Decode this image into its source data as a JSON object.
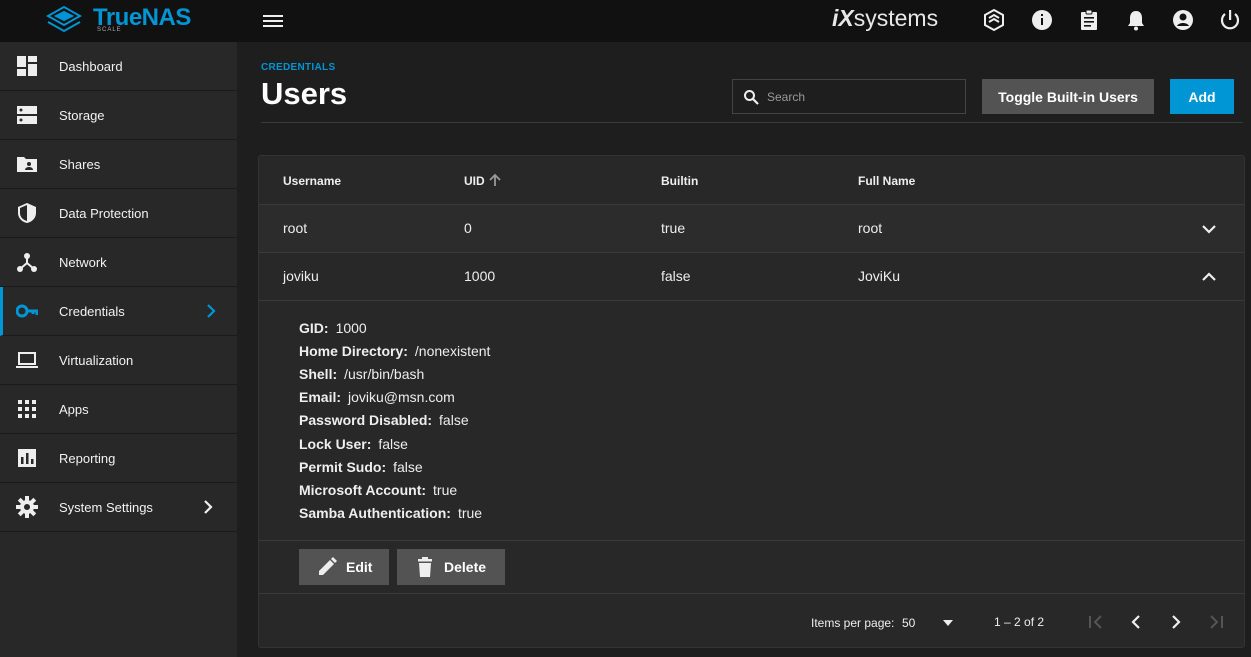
{
  "app": {
    "logo_text": "TrueNAS",
    "logo_edition": "SCALE",
    "vendor_logo_ix": "iX",
    "vendor_logo_text": "systems"
  },
  "colors": {
    "accent": "#0095d5",
    "topbar": "#111111",
    "sidebar": "#282828",
    "background": "#1e1e1e",
    "button_gray": "#535353"
  },
  "topbar": {
    "icons": [
      "hamburger-menu-icon",
      "truecommand-icon",
      "info-icon",
      "clipboard-icon",
      "bell-icon",
      "account-icon",
      "power-icon"
    ]
  },
  "sidebar": {
    "items": [
      {
        "label": "Dashboard",
        "icon": "dashboard-icon"
      },
      {
        "label": "Storage",
        "icon": "storage-icon"
      },
      {
        "label": "Shares",
        "icon": "shares-icon"
      },
      {
        "label": "Data Protection",
        "icon": "shield-icon"
      },
      {
        "label": "Network",
        "icon": "network-icon"
      },
      {
        "label": "Credentials",
        "icon": "key-icon",
        "active": true,
        "has_submenu": true
      },
      {
        "label": "Virtualization",
        "icon": "laptop-icon"
      },
      {
        "label": "Apps",
        "icon": "apps-grid-icon"
      },
      {
        "label": "Reporting",
        "icon": "chart-icon"
      },
      {
        "label": "System Settings",
        "icon": "gear-icon",
        "has_submenu": true
      }
    ]
  },
  "header": {
    "breadcrumb": "CREDENTIALS",
    "title": "Users",
    "search_placeholder": "Search",
    "toggle_button": "Toggle Built-in Users",
    "add_button": "Add"
  },
  "table": {
    "columns": [
      "Username",
      "UID",
      "Builtin",
      "Full Name"
    ],
    "sorted_column": "UID",
    "rows": [
      {
        "username": "root",
        "uid": "0",
        "builtin": "true",
        "full_name": "root",
        "expanded": false
      },
      {
        "username": "joviku",
        "uid": "1000",
        "builtin": "false",
        "full_name": "JoviKu",
        "expanded": true
      }
    ]
  },
  "details": [
    {
      "key": "GID:",
      "value": "1000"
    },
    {
      "key": "Home Directory:",
      "value": "/nonexistent"
    },
    {
      "key": "Shell:",
      "value": "/usr/bin/bash"
    },
    {
      "key": "Email:",
      "value": "joviku@msn.com"
    },
    {
      "key": "Password Disabled:",
      "value": "false"
    },
    {
      "key": "Lock User:",
      "value": "false"
    },
    {
      "key": "Permit Sudo:",
      "value": "false"
    },
    {
      "key": "Microsoft Account:",
      "value": "true"
    },
    {
      "key": "Samba Authentication:",
      "value": "true"
    }
  ],
  "actions": {
    "edit": "Edit",
    "delete": "Delete"
  },
  "paginator": {
    "items_per_page_label": "Items per page:",
    "page_size": "50",
    "range": "1 – 2 of 2"
  }
}
